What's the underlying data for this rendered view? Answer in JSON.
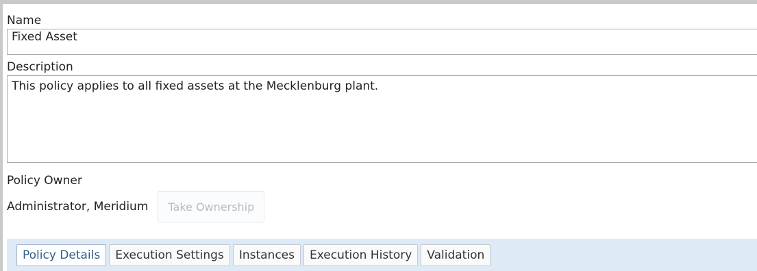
{
  "form": {
    "name_label": "Name",
    "name_value": "Fixed Asset",
    "description_label": "Description",
    "description_value": "This policy applies to all fixed assets at the Mecklenburg plant.",
    "owner_label": "Policy Owner",
    "owner_value": "Administrator, Meridium",
    "take_ownership_label": "Take Ownership",
    "take_ownership_disabled": true
  },
  "tabs": [
    {
      "label": "Policy Details",
      "active": true
    },
    {
      "label": "Execution Settings",
      "active": false
    },
    {
      "label": "Instances",
      "active": false
    },
    {
      "label": "Execution History",
      "active": false
    },
    {
      "label": "Validation",
      "active": false
    }
  ],
  "colors": {
    "tabbar_background": "#deeaf6",
    "active_tab_text": "#2e5f8a",
    "disabled_button_text": "#b5bcc4"
  }
}
